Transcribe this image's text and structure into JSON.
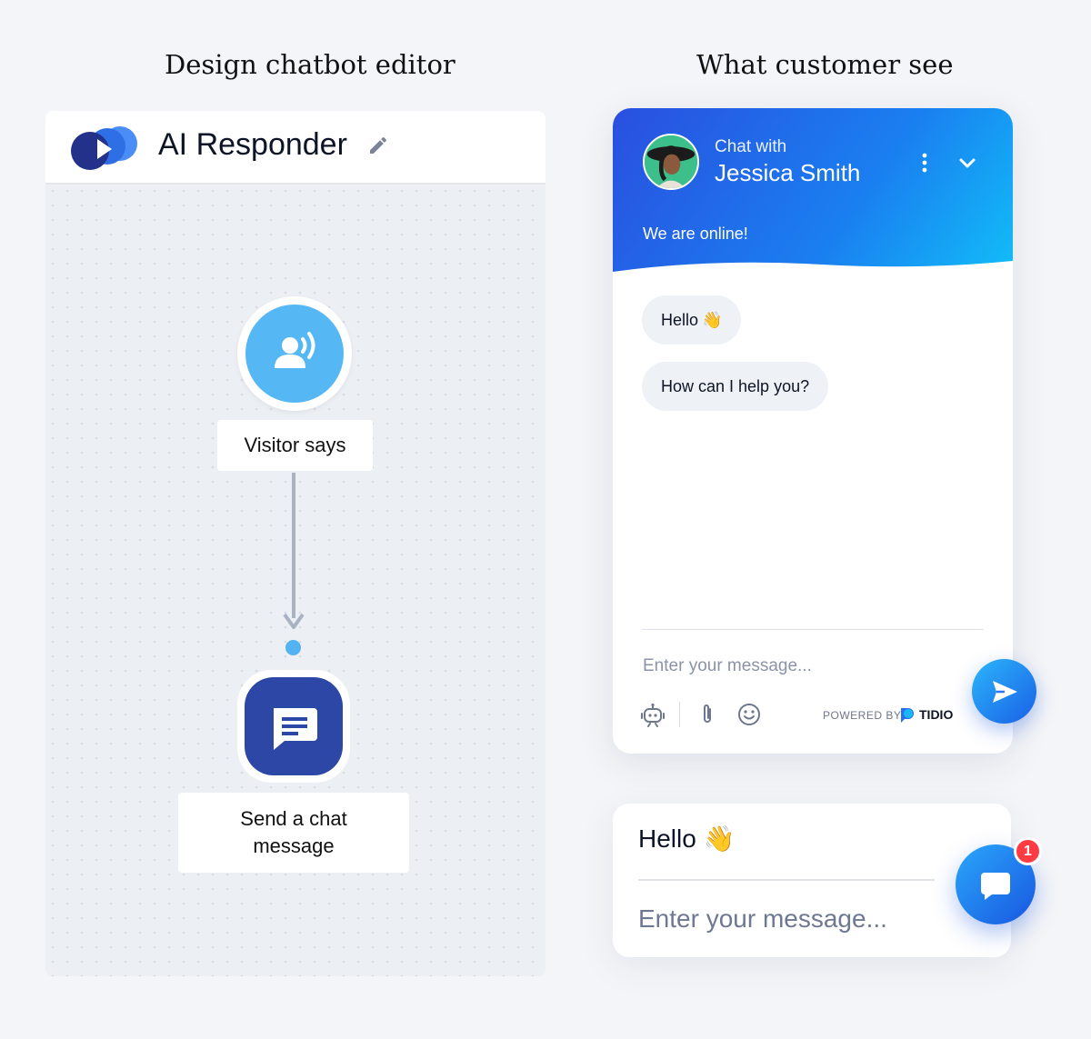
{
  "headings": {
    "left": "Design chatbot editor",
    "right": "What customer see"
  },
  "editor": {
    "title": "AI Responder",
    "nodes": {
      "trigger_label": "Visitor says",
      "action_label": "Send a chat\nmessage"
    },
    "colors": {
      "trigger_node": "#56b7f5",
      "action_node": "#2c47a6"
    }
  },
  "chat": {
    "header_prefix": "Chat with",
    "agent_name": "Jessica Smith",
    "status": "We are online!",
    "messages": [
      {
        "text": "Hello",
        "emoji": "👋"
      },
      {
        "text": "How can I help you?"
      }
    ],
    "input_placeholder": "Enter your message...",
    "powered_by": "POWERED BY",
    "brand": "TIDIO",
    "icons": [
      "bot-icon",
      "paperclip-icon",
      "smiley-icon",
      "send-icon"
    ]
  },
  "mini": {
    "greeting": "Hello",
    "emoji": "👋",
    "input_placeholder": "Enter your message...",
    "badge_count": "1"
  }
}
